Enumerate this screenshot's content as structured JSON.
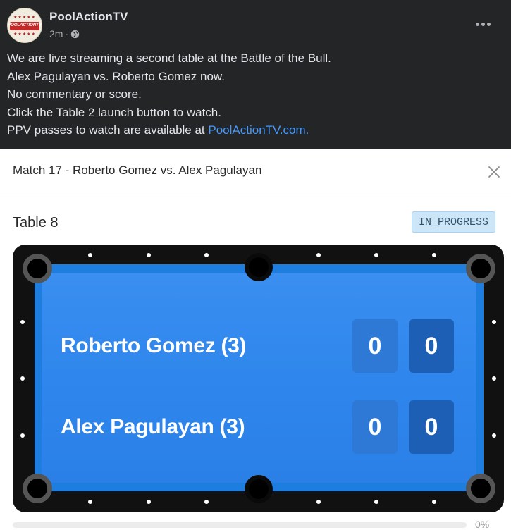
{
  "post": {
    "page_name": "PoolActionTV",
    "time": "2m",
    "separator": "·",
    "avatar": {
      "line1": "★★★★★",
      "brand": "POOLACTIONTV",
      "line2": "★★★★★"
    },
    "lines": [
      "We are live streaming a second table at the Battle of the Bull.",
      "Alex Pagulayan vs. Roberto Gomez now.",
      "No commentary or score.",
      "Click the Table 2 launch button to watch."
    ],
    "last_line_prefix": "PPV passes to watch are available at ",
    "link_text": "PoolActionTV.com."
  },
  "card": {
    "match_title": "Match 17 - Roberto Gomez vs. Alex Pagulayan",
    "table_label": "Table 8",
    "status": "IN_PROGRESS",
    "players": [
      {
        "name": "Roberto Gomez (3)",
        "score_a": "0",
        "score_b": "0"
      },
      {
        "name": "Alex Pagulayan (3)",
        "score_a": "0",
        "score_b": "0"
      }
    ],
    "progress_value": 0,
    "progress_text": "0%"
  },
  "colors": {
    "background": "#242526",
    "text": "#e4e6eb",
    "link": "#4599ff",
    "felt": "#2f86ec",
    "status_bg": "#cce5f7"
  },
  "icons": [
    "globe-icon",
    "more-icon",
    "close-icon"
  ]
}
